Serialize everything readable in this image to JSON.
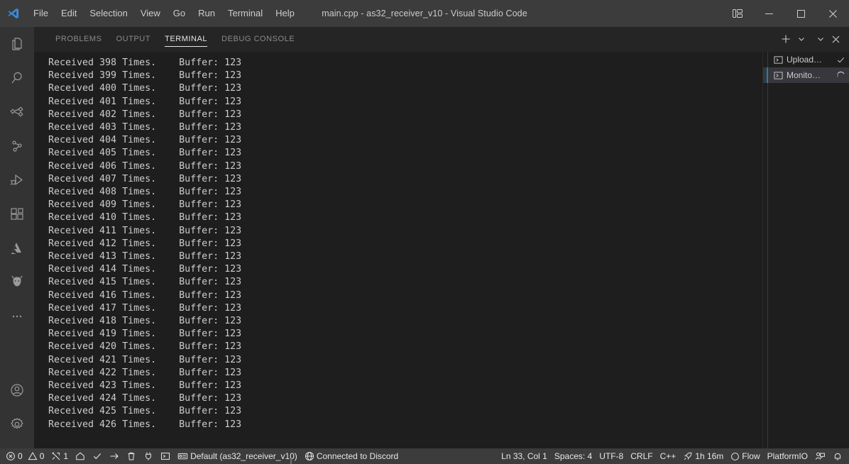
{
  "window": {
    "title": "main.cpp - as32_receiver_v10 - Visual Studio Code",
    "logo_name": "vscode-logo",
    "layout_button_label": "Customize Layout",
    "minimize_label": "Minimize",
    "maximize_label": "Maximize",
    "close_label": "Close"
  },
  "menubar": {
    "items": [
      {
        "label": "File"
      },
      {
        "label": "Edit"
      },
      {
        "label": "Selection"
      },
      {
        "label": "View"
      },
      {
        "label": "Go"
      },
      {
        "label": "Run"
      },
      {
        "label": "Terminal"
      },
      {
        "label": "Help"
      }
    ]
  },
  "activitybar": {
    "top_items": [
      {
        "name": "explorer",
        "icon": "files-icon",
        "tooltip": "Explorer"
      },
      {
        "name": "search",
        "icon": "search-icon",
        "tooltip": "Search"
      },
      {
        "name": "source-control",
        "icon": "source-control-icon",
        "tooltip": "Source Control"
      },
      {
        "name": "testing",
        "icon": "branch-icon",
        "tooltip": "Testing"
      },
      {
        "name": "run-and-debug",
        "icon": "run-debug-icon",
        "tooltip": "Run and Debug"
      },
      {
        "name": "extensions",
        "icon": "extensions-icon",
        "tooltip": "Extensions"
      },
      {
        "name": "azure",
        "icon": "azure-icon",
        "tooltip": "Azure"
      },
      {
        "name": "platformio",
        "icon": "platformio-ant-icon",
        "tooltip": "PlatformIO"
      },
      {
        "name": "more",
        "icon": "ellipsis-icon",
        "tooltip": "Additional Views"
      }
    ],
    "bottom_items": [
      {
        "name": "accounts",
        "icon": "account-icon",
        "tooltip": "Accounts"
      },
      {
        "name": "settings",
        "icon": "gear-icon",
        "tooltip": "Manage"
      }
    ]
  },
  "panel": {
    "tabs": [
      {
        "label": "PROBLEMS",
        "active": false
      },
      {
        "label": "OUTPUT",
        "active": false
      },
      {
        "label": "TERMINAL",
        "active": true
      },
      {
        "label": "DEBUG CONSOLE",
        "active": false
      }
    ],
    "actions": [
      {
        "name": "new-terminal-button",
        "icon": "plus-icon",
        "label": "New Terminal"
      },
      {
        "name": "terminal-profile-dropdown",
        "icon": "chevron-down-icon",
        "label": "Launch Profile"
      },
      {
        "name": "panel-views-dropdown",
        "icon": "chevron-down-icon",
        "label": "Views and More Actions"
      },
      {
        "name": "close-panel-button",
        "icon": "close-icon",
        "label": "Close Panel"
      }
    ],
    "terminal_tabs": [
      {
        "label": "Upload…",
        "icon": "terminal-icon",
        "status": "check",
        "active": false
      },
      {
        "label": "Monito…",
        "icon": "terminal-icon",
        "status": "spinner",
        "active": true
      }
    ]
  },
  "terminal": {
    "lines": [
      "Received 398 Times.    Buffer: 123",
      "Received 399 Times.    Buffer: 123",
      "Received 400 Times.    Buffer: 123",
      "Received 401 Times.    Buffer: 123",
      "Received 402 Times.    Buffer: 123",
      "Received 403 Times.    Buffer: 123",
      "Received 404 Times.    Buffer: 123",
      "Received 405 Times.    Buffer: 123",
      "Received 406 Times.    Buffer: 123",
      "Received 407 Times.    Buffer: 123",
      "Received 408 Times.    Buffer: 123",
      "Received 409 Times.    Buffer: 123",
      "Received 410 Times.    Buffer: 123",
      "Received 411 Times.    Buffer: 123",
      "Received 412 Times.    Buffer: 123",
      "Received 413 Times.    Buffer: 123",
      "Received 414 Times.    Buffer: 123",
      "Received 415 Times.    Buffer: 123",
      "Received 416 Times.    Buffer: 123",
      "Received 417 Times.    Buffer: 123",
      "Received 418 Times.    Buffer: 123",
      "Received 419 Times.    Buffer: 123",
      "Received 420 Times.    Buffer: 123",
      "Received 421 Times.    Buffer: 123",
      "Received 422 Times.    Buffer: 123",
      "Received 423 Times.    Buffer: 123",
      "Received 424 Times.    Buffer: 123",
      "Received 425 Times.    Buffer: 123",
      "Received 426 Times.    Buffer: 123"
    ]
  },
  "statusbar": {
    "left": [
      {
        "name": "problems-errors",
        "icon": "error-icon",
        "text": "0"
      },
      {
        "name": "problems-warnings",
        "icon": "warning-icon",
        "text": "0"
      },
      {
        "name": "platformio-tasks",
        "icon": "tools-icon",
        "text": "1"
      },
      {
        "name": "pio-home",
        "icon": "home-icon",
        "text": ""
      },
      {
        "name": "pio-build",
        "icon": "check-icon",
        "text": ""
      },
      {
        "name": "pio-upload",
        "icon": "arrow-right-icon",
        "text": ""
      },
      {
        "name": "pio-clean",
        "icon": "trash-icon",
        "text": ""
      },
      {
        "name": "pio-serial-monitor",
        "icon": "plug-icon",
        "text": ""
      },
      {
        "name": "pio-new-terminal",
        "icon": "terminal-icon",
        "text": ""
      },
      {
        "name": "pio-environment",
        "icon": "folder-env-icon",
        "text": "Default (as32_receiver_v10)"
      },
      {
        "name": "discord-status",
        "icon": "globe-icon",
        "text": "Connected to Discord"
      }
    ],
    "right": [
      {
        "name": "editor-position",
        "icon": "",
        "text": "Ln 33, Col 1"
      },
      {
        "name": "indentation",
        "icon": "",
        "text": "Spaces: 4"
      },
      {
        "name": "encoding",
        "icon": "",
        "text": "UTF-8"
      },
      {
        "name": "line-endings",
        "icon": "",
        "text": "CRLF"
      },
      {
        "name": "language-mode",
        "icon": "",
        "text": "C++"
      },
      {
        "name": "wakatime",
        "icon": "rocket-icon",
        "text": "1h 16m"
      },
      {
        "name": "flow",
        "icon": "circle-icon",
        "text": "Flow"
      },
      {
        "name": "platformio-label",
        "icon": "",
        "text": "PlatformIO"
      },
      {
        "name": "remote-feedback",
        "icon": "feedback-icon",
        "text": ""
      },
      {
        "name": "notifications",
        "icon": "bell-icon",
        "text": ""
      }
    ]
  },
  "colors": {
    "titlebar_bg": "#3c3c3c",
    "activitybar_bg": "#333333",
    "panel_bg": "#1e1e1e",
    "panel_header_bg": "#252526",
    "statusbar_bg": "#3c3c3c",
    "accent": "#0c8ca8",
    "terminal_text": "#cccccc",
    "active_tab_bg": "#37373d"
  }
}
